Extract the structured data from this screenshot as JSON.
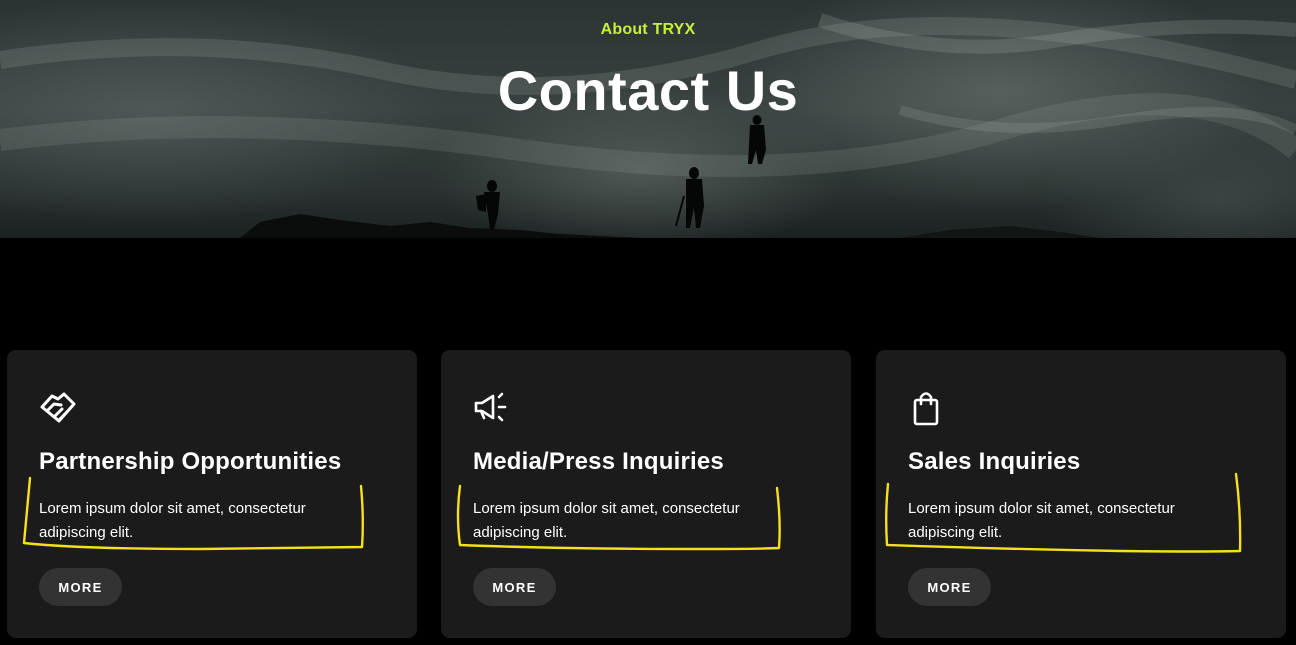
{
  "hero": {
    "eyebrow": "About TRYX",
    "title": "Contact Us"
  },
  "cards": [
    {
      "icon": "handshake-icon",
      "title": "Partnership Opportunities",
      "description": "Lorem ipsum dolor sit amet, consectetur adipiscing elit.",
      "button_label": "MORE"
    },
    {
      "icon": "megaphone-icon",
      "title": "Media/Press Inquiries",
      "description": "Lorem ipsum dolor sit amet, consectetur adipiscing elit.",
      "button_label": "MORE"
    },
    {
      "icon": "shopping-bag-icon",
      "title": "Sales Inquiries",
      "description": "Lorem ipsum dolor sit amet, consectetur adipiscing elit.",
      "button_label": "MORE"
    }
  ],
  "colors": {
    "accent": "#c5f03b",
    "card_background": "#1b1b1b",
    "button_background": "#333333",
    "annotation": "#f5e01c"
  }
}
